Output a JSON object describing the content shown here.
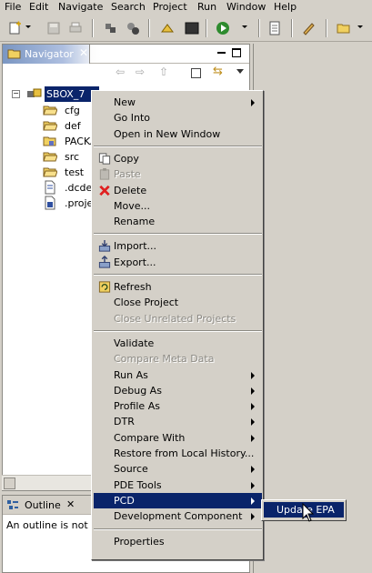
{
  "menubar": {
    "items": [
      "File",
      "Edit",
      "Navigate",
      "Search",
      "Project",
      "Run",
      "Window",
      "Help"
    ]
  },
  "navigator": {
    "title": "Navigator",
    "root_label": "SBOX_7",
    "tree_items": [
      {
        "label": "cfg",
        "icon": "folder-icon"
      },
      {
        "label": "def",
        "icon": "folder-icon"
      },
      {
        "label": "PACKA",
        "icon": "package-folder-icon"
      },
      {
        "label": "src",
        "icon": "folder-icon"
      },
      {
        "label": "test",
        "icon": "folder-icon"
      },
      {
        "label": ".dcde",
        "icon": "file-icon"
      },
      {
        "label": ".proje",
        "icon": "project-file-icon"
      }
    ]
  },
  "outline": {
    "title": "Outline",
    "message": "An outline is not av"
  },
  "context_menu": {
    "groups": [
      [
        {
          "label": "New",
          "submenu": true
        },
        {
          "label": "Go Into"
        },
        {
          "label": "Open in New Window"
        }
      ],
      [
        {
          "label": "Copy",
          "icon": "copy-icon"
        },
        {
          "label": "Paste",
          "icon": "paste-icon",
          "disabled": true
        },
        {
          "label": "Delete",
          "icon": "delete-icon"
        },
        {
          "label": "Move..."
        },
        {
          "label": "Rename"
        }
      ],
      [
        {
          "label": "Import...",
          "icon": "import-icon"
        },
        {
          "label": "Export...",
          "icon": "export-icon"
        }
      ],
      [
        {
          "label": "Refresh",
          "icon": "refresh-icon"
        },
        {
          "label": "Close Project"
        },
        {
          "label": "Close Unrelated Projects",
          "disabled": true
        }
      ],
      [
        {
          "label": "Validate"
        },
        {
          "label": "Compare Meta Data",
          "disabled": true
        },
        {
          "label": "Run As",
          "submenu": true
        },
        {
          "label": "Debug As",
          "submenu": true
        },
        {
          "label": "Profile As",
          "submenu": true
        },
        {
          "label": "DTR",
          "submenu": true
        },
        {
          "label": "Compare With",
          "submenu": true
        },
        {
          "label": "Restore from Local History..."
        },
        {
          "label": "Source",
          "submenu": true
        },
        {
          "label": "PDE Tools",
          "submenu": true
        },
        {
          "label": "PCD",
          "submenu": true,
          "active": true
        },
        {
          "label": "Development Component",
          "submenu": true
        }
      ],
      [
        {
          "label": "Properties"
        }
      ]
    ]
  },
  "submenu": {
    "item_label": "Update EPA"
  },
  "colors": {
    "selection": "#0a246a",
    "chrome": "#d4d0c8",
    "disabled_text": "#8c8a84"
  }
}
